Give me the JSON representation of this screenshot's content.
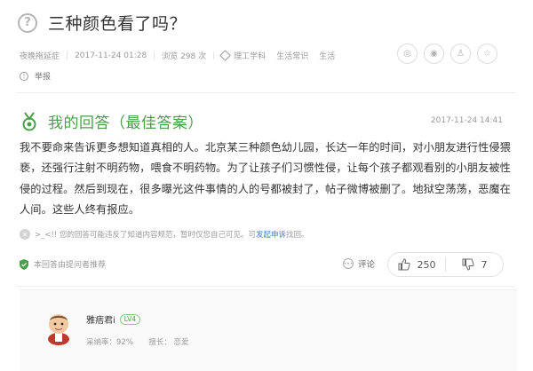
{
  "question": {
    "icon": "?",
    "title": "三种颜色看了吗？",
    "author": "夜晚拖延症",
    "time": "2017-11-24 01:28",
    "views": "浏览 298 次",
    "tags": [
      "理工学科",
      "生活常识",
      "生活"
    ],
    "report_label": "举报"
  },
  "share": {
    "icons": [
      "wechat-icon",
      "weibo-icon",
      "qq-icon",
      "qzone-icon"
    ],
    "glyphs": [
      "◎",
      "◉",
      "♙",
      "☆"
    ]
  },
  "answer": {
    "heading": "我的回答（最佳答案）",
    "time": "2017-11-24 14:41",
    "text": "我不要命来告诉更多想知道真相的人。北京某三种颜色幼儿园，长达一年的时间，对小朋友进行性侵猥亵，还强行注射不明药物，喂食不明药物。为了让孩子们习惯性侵，让每个孩子都观看别的小朋友被性侵的过程。然后到现在，很多曝光这件事情的人的号都被封了，帖子微博被删了。地狱空荡荡，恶魔在人间。这些人终有报应。",
    "notice_prefix": ">_<!! 您的回答可能违反了知道内容规范，暂时仅您自己可见。可",
    "notice_link": "发起申诉",
    "notice_suffix": "找回。",
    "recommend": "本回答由提问者推荐",
    "comment_label": "评论",
    "upvotes": "250",
    "downvotes": "7"
  },
  "user": {
    "name": "雅痞君i",
    "level": "LV4",
    "adoption_rate": "采纳率：92%",
    "expertise": "擅长：  恋爱"
  },
  "colors": {
    "accent_green": "#4aa04a",
    "link_blue": "#3b79d5",
    "muted_text": "#999999"
  }
}
